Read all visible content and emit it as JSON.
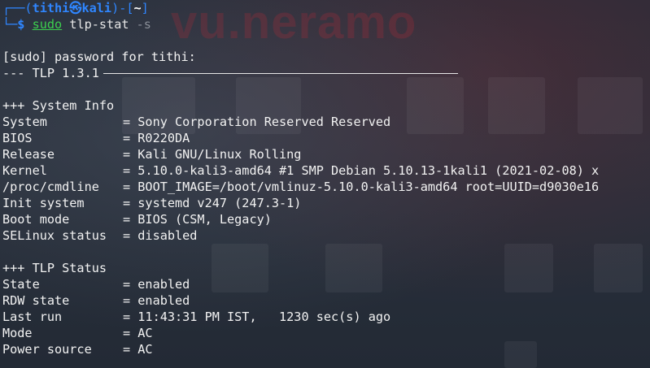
{
  "prompt": {
    "line1_prefix": "┌──(",
    "user": "tithi",
    "at_icon": "㉿",
    "host": "kali",
    "line1_mid": ")-[",
    "cwd": "~",
    "line1_suffix": "]",
    "line2_prefix": "└─",
    "dollar": "$",
    "command": "sudo",
    "args": "tlp-stat",
    "option": "-s"
  },
  "sudo_prompt": "[sudo] password for tithi:",
  "tlp_header": "--- TLP 1.3.1",
  "system_info": {
    "heading": "+++ System Info",
    "rows": [
      {
        "key": "System",
        "value": "= Sony Corporation Reserved Reserved"
      },
      {
        "key": "BIOS",
        "value": "= R0220DA"
      },
      {
        "key": "Release",
        "value": "= Kali GNU/Linux Rolling"
      },
      {
        "key": "Kernel",
        "value": "= 5.10.0-kali3-amd64 #1 SMP Debian 5.10.13-1kali1 (2021-02-08) x"
      },
      {
        "key": "/proc/cmdline",
        "value": "= BOOT_IMAGE=/boot/vmlinuz-5.10.0-kali3-amd64 root=UUID=d9030e16"
      },
      {
        "key": "Init system",
        "value": "= systemd v247 (247.3-1)"
      },
      {
        "key": "Boot mode",
        "value": "= BIOS (CSM, Legacy)"
      },
      {
        "key": "SELinux status",
        "value": "= disabled"
      }
    ]
  },
  "tlp_status": {
    "heading": "+++ TLP Status",
    "rows": [
      {
        "key": "State",
        "value": "= enabled"
      },
      {
        "key": "RDW state",
        "value": "= enabled"
      },
      {
        "key": "Last run",
        "value": "= 11:43:31 PM IST,   1230 sec(s) ago"
      },
      {
        "key": "Mode",
        "value": "= AC"
      },
      {
        "key": "Power source",
        "value": "= AC"
      }
    ]
  },
  "colors": {
    "prompt": "#2f86ff",
    "command": "#3ccf4e",
    "text": "#f2f2f2"
  }
}
